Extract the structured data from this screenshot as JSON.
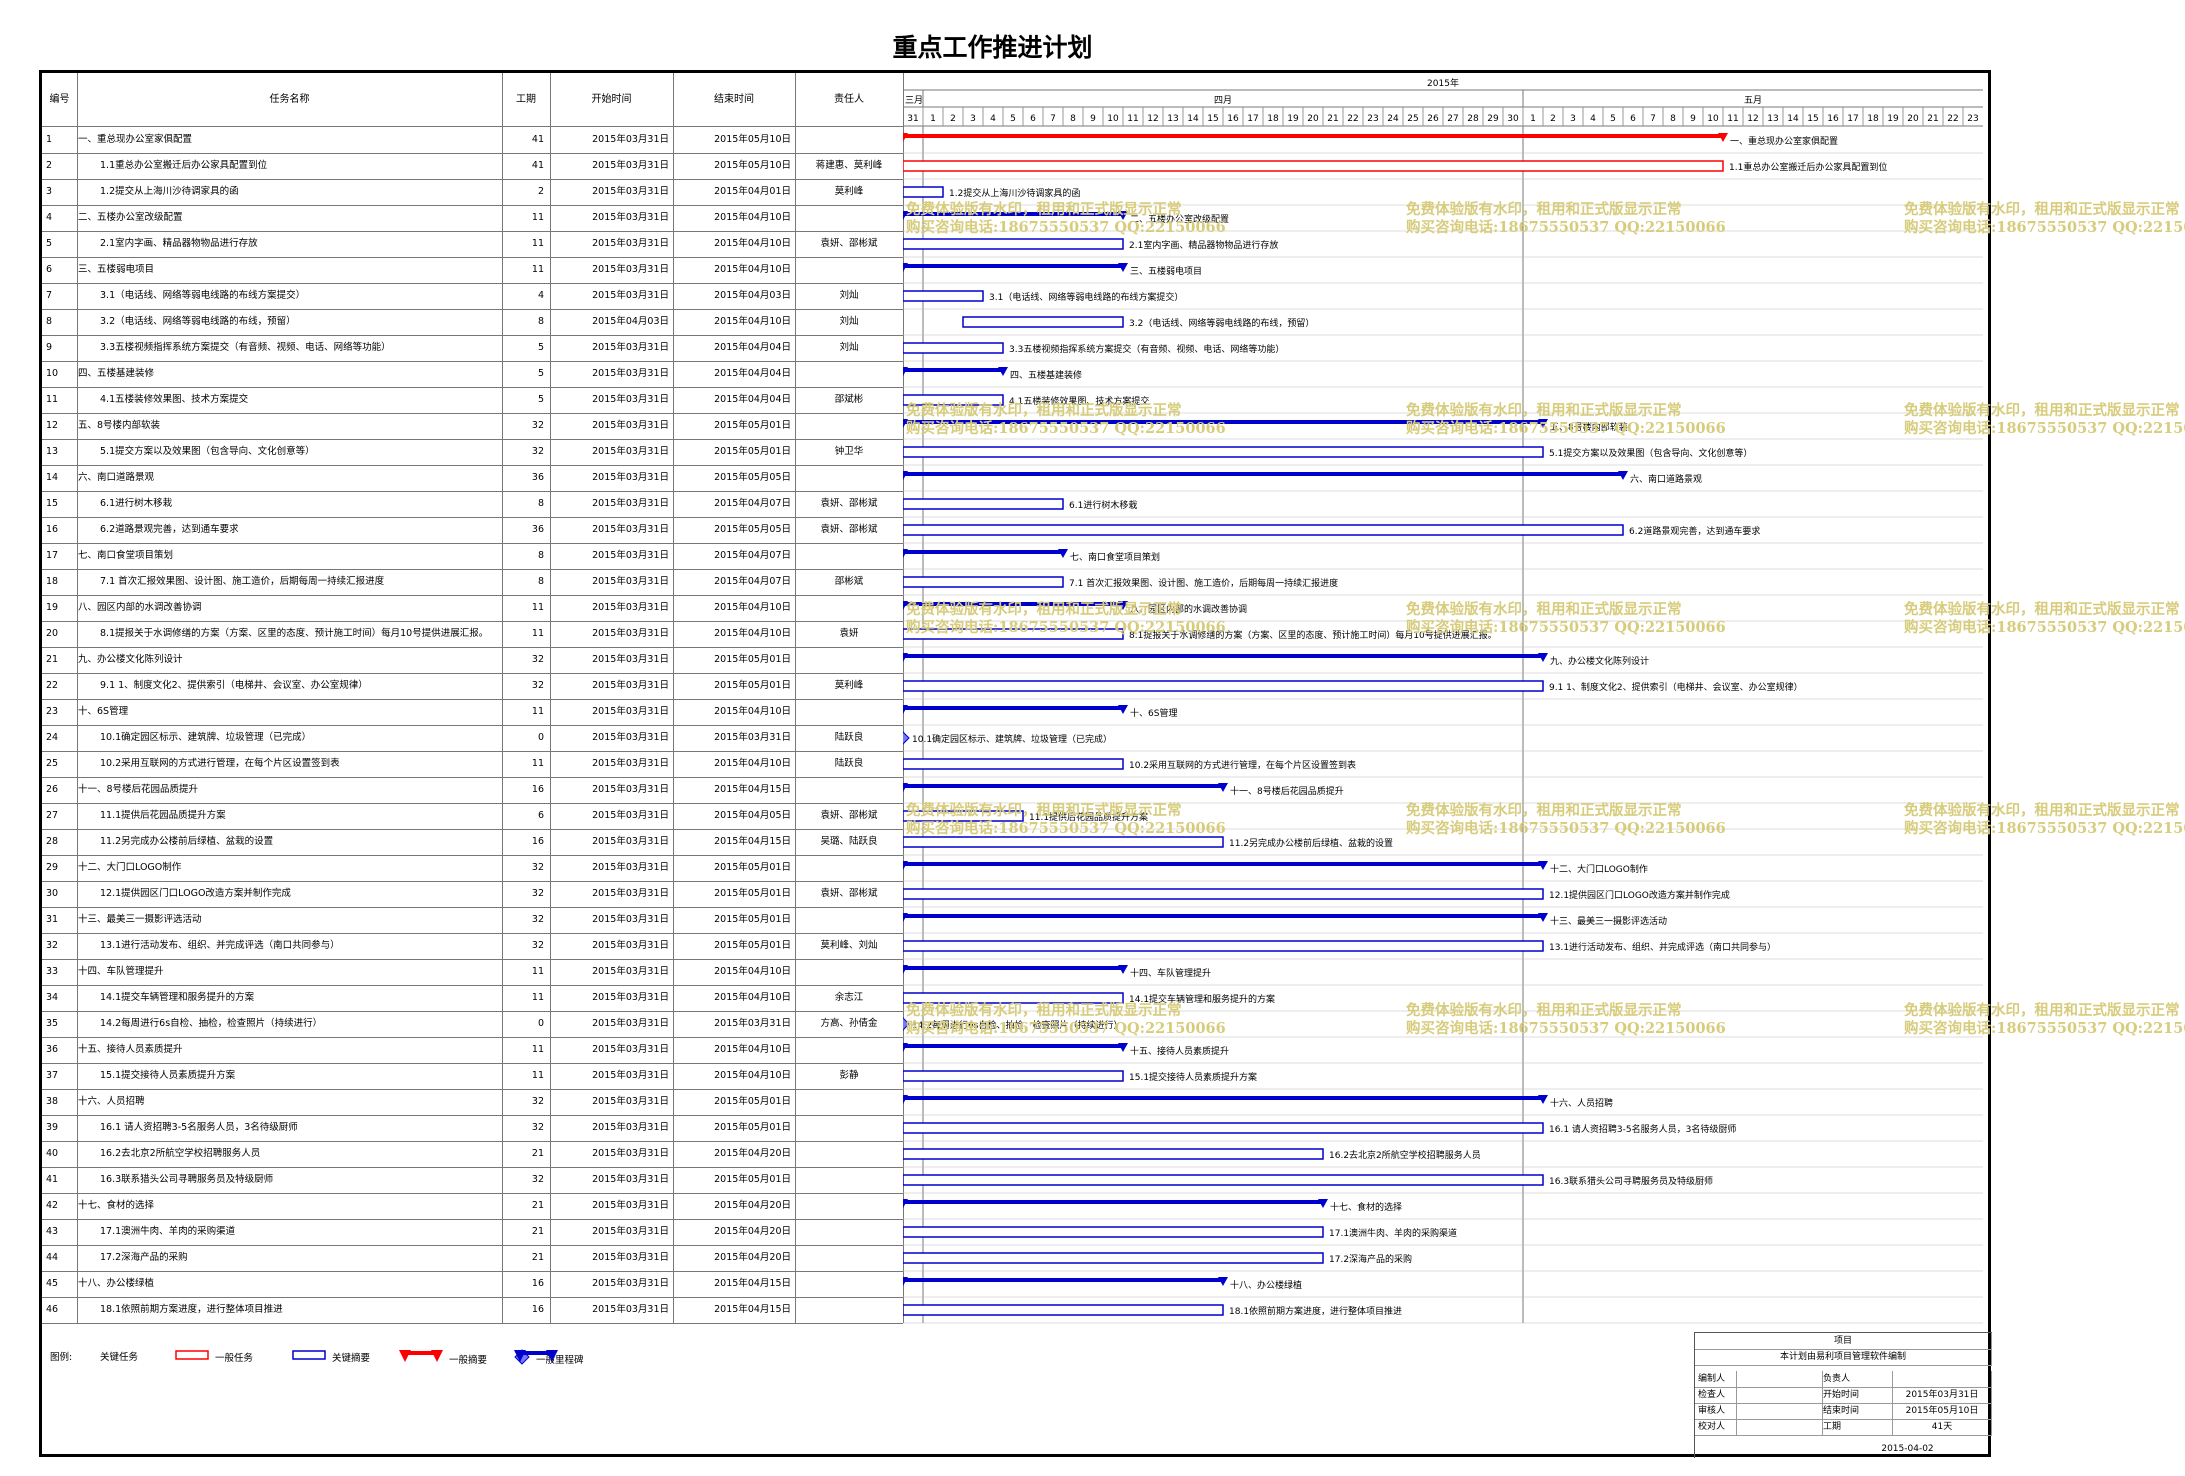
{
  "title": "重点工作推进计划",
  "columns": {
    "id": "编号",
    "name": "任务名称",
    "duration": "工期",
    "start": "开始时间",
    "end": "结束时间",
    "owner": "责任人"
  },
  "timeline": {
    "year": "2015年",
    "months": [
      {
        "label": "三月",
        "days": [
          "31"
        ]
      },
      {
        "label": "四月",
        "days": [
          "1",
          "2",
          "3",
          "4",
          "5",
          "6",
          "7",
          "8",
          "9",
          "10",
          "11",
          "12",
          "13",
          "14",
          "15",
          "16",
          "17",
          "18",
          "19",
          "20",
          "21",
          "22",
          "23",
          "24",
          "25",
          "26",
          "27",
          "28",
          "29",
          "30"
        ]
      },
      {
        "label": "五月",
        "days": [
          "1",
          "2",
          "3",
          "4",
          "5",
          "6",
          "7",
          "8",
          "9",
          "10",
          "11",
          "12",
          "13",
          "14",
          "15",
          "16",
          "17",
          "18",
          "19",
          "20",
          "21",
          "22",
          "23"
        ]
      }
    ]
  },
  "chart_data": {
    "type": "gantt",
    "title": "重点工作推进计划",
    "x_axis": {
      "start": "2015-03-31",
      "end": "2015-05-23",
      "unit": "day"
    },
    "tasks": [
      {
        "id": "1",
        "name": "一、重总现办公室家俱配置",
        "duration": "41",
        "start": "2015年03月31日",
        "end": "2015年05月10日",
        "owner": "",
        "kind": "summary-general"
      },
      {
        "id": "2",
        "name": "1.1重总办公室搬迁后办公家具配置到位",
        "duration": "41",
        "start": "2015年03月31日",
        "end": "2015年05月10日",
        "owner": "蒋建惠、莫利峰",
        "kind": "general"
      },
      {
        "id": "3",
        "name": "1.2提交从上海川沙待调家具的函",
        "duration": "2",
        "start": "2015年03月31日",
        "end": "2015年04月01日",
        "owner": "莫利峰",
        "kind": "key"
      },
      {
        "id": "4",
        "name": "二、五楼办公室改级配置",
        "duration": "11",
        "start": "2015年03月31日",
        "end": "2015年04月10日",
        "owner": "",
        "kind": "summary"
      },
      {
        "id": "5",
        "name": "2.1室内字画、精品器物物品进行存放",
        "duration": "11",
        "start": "2015年03月31日",
        "end": "2015年04月10日",
        "owner": "袁妍、邵彬斌",
        "kind": "key"
      },
      {
        "id": "6",
        "name": "三、五楼弱电项目",
        "duration": "11",
        "start": "2015年03月31日",
        "end": "2015年04月10日",
        "owner": "",
        "kind": "summary"
      },
      {
        "id": "7",
        "name": "3.1（电话线、网络等弱电线路的布线方案提交）",
        "duration": "4",
        "start": "2015年03月31日",
        "end": "2015年04月03日",
        "owner": "刘灿",
        "kind": "key"
      },
      {
        "id": "8",
        "name": "3.2（电话线、网络等弱电线路的布线，预留）",
        "duration": "8",
        "start": "2015年04月03日",
        "end": "2015年04月10日",
        "owner": "刘灿",
        "kind": "key"
      },
      {
        "id": "9",
        "name": "3.3五楼视频指挥系统方案提交（有音频、视频、电话、网络等功能）",
        "duration": "5",
        "start": "2015年03月31日",
        "end": "2015年04月04日",
        "owner": "刘灿",
        "kind": "key"
      },
      {
        "id": "10",
        "name": "四、五楼基建装修",
        "duration": "5",
        "start": "2015年03月31日",
        "end": "2015年04月04日",
        "owner": "",
        "kind": "summary"
      },
      {
        "id": "11",
        "name": "4.1五楼装修效果图、技术方案提交",
        "duration": "5",
        "start": "2015年03月31日",
        "end": "2015年04月04日",
        "owner": "邵斌彬",
        "kind": "key"
      },
      {
        "id": "12",
        "name": "五、8号楼内部软装",
        "duration": "32",
        "start": "2015年03月31日",
        "end": "2015年05月01日",
        "owner": "",
        "kind": "summary"
      },
      {
        "id": "13",
        "name": "5.1提交方案以及效果图（包含导向、文化创意等）",
        "duration": "32",
        "start": "2015年03月31日",
        "end": "2015年05月01日",
        "owner": "钟卫华",
        "kind": "key"
      },
      {
        "id": "14",
        "name": "六、南口道路景观",
        "duration": "36",
        "start": "2015年03月31日",
        "end": "2015年05月05日",
        "owner": "",
        "kind": "summary"
      },
      {
        "id": "15",
        "name": "6.1进行树木移栽",
        "duration": "8",
        "start": "2015年03月31日",
        "end": "2015年04月07日",
        "owner": "袁妍、邵彬斌",
        "kind": "key"
      },
      {
        "id": "16",
        "name": "6.2道路景观完善，达到通车要求",
        "duration": "36",
        "start": "2015年03月31日",
        "end": "2015年05月05日",
        "owner": "袁妍、邵彬斌",
        "kind": "key"
      },
      {
        "id": "17",
        "name": "七、南口食堂项目策划",
        "duration": "8",
        "start": "2015年03月31日",
        "end": "2015年04月07日",
        "owner": "",
        "kind": "summary"
      },
      {
        "id": "18",
        "name": "7.1 首次汇报效果图、设计图、施工造价，后期每周一持续汇报进度",
        "duration": "8",
        "start": "2015年03月31日",
        "end": "2015年04月07日",
        "owner": "邵彬斌",
        "kind": "key"
      },
      {
        "id": "19",
        "name": "八、园区内部的水调改善协调",
        "duration": "11",
        "start": "2015年03月31日",
        "end": "2015年04月10日",
        "owner": "",
        "kind": "summary"
      },
      {
        "id": "20",
        "name": "8.1提报关于水调修缮的方案（方案、区里的态度、预计施工时间）每月10号提供进展汇报。",
        "duration": "11",
        "start": "2015年03月31日",
        "end": "2015年04月10日",
        "owner": "袁妍",
        "kind": "key"
      },
      {
        "id": "21",
        "name": "九、办公楼文化陈列设计",
        "duration": "32",
        "start": "2015年03月31日",
        "end": "2015年05月01日",
        "owner": "",
        "kind": "summary"
      },
      {
        "id": "22",
        "name": "9.1 1、制度文化2、提供索引（电梯井、会议室、办公室规律）",
        "duration": "32",
        "start": "2015年03月31日",
        "end": "2015年05月01日",
        "owner": "莫利峰",
        "kind": "key"
      },
      {
        "id": "23",
        "name": "十、6S管理",
        "duration": "11",
        "start": "2015年03月31日",
        "end": "2015年04月10日",
        "owner": "",
        "kind": "summary"
      },
      {
        "id": "24",
        "name": "10.1确定园区标示、建筑牌、垃圾管理（已完成）",
        "duration": "0",
        "start": "2015年03月31日",
        "end": "2015年03月31日",
        "owner": "陆跃良",
        "kind": "milestone"
      },
      {
        "id": "25",
        "name": "10.2采用互联网的方式进行管理，在每个片区设置签到表",
        "duration": "11",
        "start": "2015年03月31日",
        "end": "2015年04月10日",
        "owner": "陆跃良",
        "kind": "key"
      },
      {
        "id": "26",
        "name": "十一、8号楼后花园品质提升",
        "duration": "16",
        "start": "2015年03月31日",
        "end": "2015年04月15日",
        "owner": "",
        "kind": "summary"
      },
      {
        "id": "27",
        "name": "11.1提供后花园品质提升方案",
        "duration": "6",
        "start": "2015年03月31日",
        "end": "2015年04月05日",
        "owner": "袁妍、邵彬斌",
        "kind": "key"
      },
      {
        "id": "28",
        "name": "11.2另完成办公楼前后绿植、盆栽的设置",
        "duration": "16",
        "start": "2015年03月31日",
        "end": "2015年04月15日",
        "owner": "吴璐、陆跃良",
        "kind": "key"
      },
      {
        "id": "29",
        "name": "十二、大门口LOGO制作",
        "duration": "32",
        "start": "2015年03月31日",
        "end": "2015年05月01日",
        "owner": "",
        "kind": "summary"
      },
      {
        "id": "30",
        "name": "12.1提供园区门口LOGO改造方案并制作完成",
        "duration": "32",
        "start": "2015年03月31日",
        "end": "2015年05月01日",
        "owner": "袁妍、邵彬斌",
        "kind": "key"
      },
      {
        "id": "31",
        "name": "十三、最美三一摄影评选活动",
        "duration": "32",
        "start": "2015年03月31日",
        "end": "2015年05月01日",
        "owner": "",
        "kind": "summary"
      },
      {
        "id": "32",
        "name": "13.1进行活动发布、组织、并完成评选（南口共同参与）",
        "duration": "32",
        "start": "2015年03月31日",
        "end": "2015年05月01日",
        "owner": "莫利峰、刘灿",
        "kind": "key"
      },
      {
        "id": "33",
        "name": "十四、车队管理提升",
        "duration": "11",
        "start": "2015年03月31日",
        "end": "2015年04月10日",
        "owner": "",
        "kind": "summary"
      },
      {
        "id": "34",
        "name": "14.1提交车辆管理和服务提升的方案",
        "duration": "11",
        "start": "2015年03月31日",
        "end": "2015年04月10日",
        "owner": "余志江",
        "kind": "key"
      },
      {
        "id": "35",
        "name": "14.2每周进行6s自检、抽检，检查照片（持续进行）",
        "duration": "0",
        "start": "2015年03月31日",
        "end": "2015年03月31日",
        "owner": "方高、孙倩金",
        "kind": "milestone"
      },
      {
        "id": "36",
        "name": "十五、接待人员素质提升",
        "duration": "11",
        "start": "2015年03月31日",
        "end": "2015年04月10日",
        "owner": "",
        "kind": "summary"
      },
      {
        "id": "37",
        "name": "15.1提交接待人员素质提升方案",
        "duration": "11",
        "start": "2015年03月31日",
        "end": "2015年04月10日",
        "owner": "彭静",
        "kind": "key"
      },
      {
        "id": "38",
        "name": "十六、人员招聘",
        "duration": "32",
        "start": "2015年03月31日",
        "end": "2015年05月01日",
        "owner": "",
        "kind": "summary"
      },
      {
        "id": "39",
        "name": "16.1 请人资招聘3-5名服务人员，3名待级厨师",
        "duration": "32",
        "start": "2015年03月31日",
        "end": "2015年05月01日",
        "owner": "",
        "kind": "key"
      },
      {
        "id": "40",
        "name": "16.2去北京2所航空学校招聘服务人员",
        "duration": "21",
        "start": "2015年03月31日",
        "end": "2015年04月20日",
        "owner": "",
        "kind": "key"
      },
      {
        "id": "41",
        "name": "16.3联系猎头公司寻聘服务员及特级厨师",
        "duration": "32",
        "start": "2015年03月31日",
        "end": "2015年05月01日",
        "owner": "",
        "kind": "key"
      },
      {
        "id": "42",
        "name": "十七、食材的选择",
        "duration": "21",
        "start": "2015年03月31日",
        "end": "2015年04月20日",
        "owner": "",
        "kind": "summary"
      },
      {
        "id": "43",
        "name": "17.1澳洲牛肉、羊肉的采购渠道",
        "duration": "21",
        "start": "2015年03月31日",
        "end": "2015年04月20日",
        "owner": "",
        "kind": "key"
      },
      {
        "id": "44",
        "name": "17.2深海产品的采购",
        "duration": "21",
        "start": "2015年03月31日",
        "end": "2015年04月20日",
        "owner": "",
        "kind": "key"
      },
      {
        "id": "45",
        "name": "十八、办公楼绿植",
        "duration": "16",
        "start": "2015年03月31日",
        "end": "2015年04月15日",
        "owner": "",
        "kind": "summary"
      },
      {
        "id": "46",
        "name": "18.1依照前期方案进度，进行整体项目推进",
        "duration": "16",
        "start": "2015年03月31日",
        "end": "2015年04月15日",
        "owner": "",
        "kind": "key"
      }
    ]
  },
  "legend": {
    "label": "图例:",
    "items": [
      "关键任务",
      "一般任务",
      "关键摘要",
      "一般摘要",
      "一般里程碑"
    ]
  },
  "info": {
    "project_label": "项目",
    "description": "本计划由易利项目管理软件编制",
    "rows": [
      [
        "编制人",
        "",
        "负责人",
        ""
      ],
      [
        "检查人",
        "",
        "开始时间",
        "2015年03月31日"
      ],
      [
        "审核人",
        "",
        "结束时间",
        "2015年05月10日"
      ],
      [
        "校对人",
        "",
        "工期",
        "41天"
      ]
    ],
    "date": "2015-04-02"
  },
  "watermark": {
    "line1": "免费体验版有水印，租用和正式版显示正常",
    "line2": "购买咨询电话:18675550537 QQ:22150066"
  },
  "colors": {
    "key": "#0000cc",
    "general": "#ff0000",
    "grid": "#777777",
    "watermark": "#d7cc7c"
  }
}
